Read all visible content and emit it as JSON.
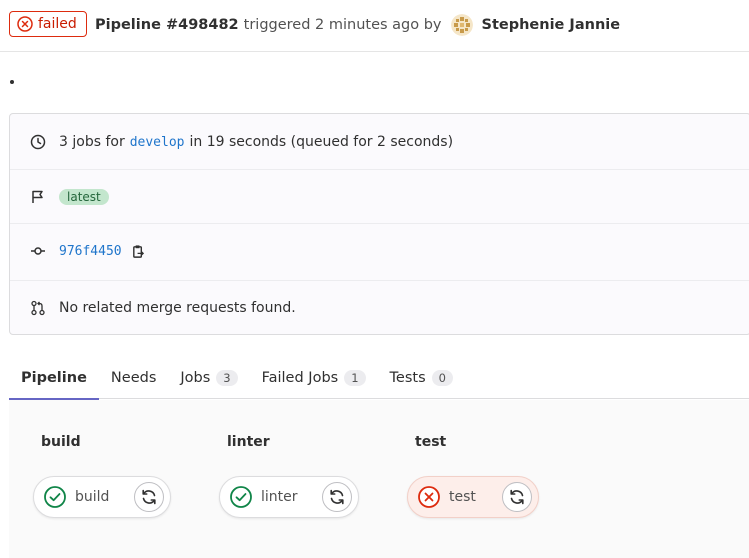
{
  "header": {
    "status": "failed",
    "pipeline_title": "Pipeline #498482",
    "meta": "triggered 2 minutes ago by",
    "author": "Stephenie Jannie"
  },
  "info": {
    "jobs_prefix": "3 jobs for",
    "branch": "develop",
    "jobs_suffix": "in 19 seconds (queued for 2 seconds)",
    "tag": "latest",
    "commit": "976f4450",
    "merge_requests": "No related merge requests found."
  },
  "tabs": [
    {
      "label": "Pipeline",
      "count": null,
      "active": true
    },
    {
      "label": "Needs",
      "count": null
    },
    {
      "label": "Jobs",
      "count": "3"
    },
    {
      "label": "Failed Jobs",
      "count": "1"
    },
    {
      "label": "Tests",
      "count": "0"
    }
  ],
  "stages": [
    {
      "title": "build",
      "job": "build",
      "status": "success"
    },
    {
      "title": "linter",
      "job": "linter",
      "status": "success"
    },
    {
      "title": "test",
      "job": "test",
      "status": "failed"
    }
  ],
  "colors": {
    "failed": "#dd2b0e",
    "success": "#108548",
    "link": "#1f75cb",
    "tab_active": "#6666c4"
  },
  "icons": {
    "status_failed": "status-failed-icon",
    "clock": "clock-icon",
    "flag": "flag-icon",
    "commit": "commit-icon",
    "copy": "copy-icon",
    "merge_request": "merge-request-icon",
    "retry": "retry-icon",
    "status_success": "status-success-icon"
  }
}
